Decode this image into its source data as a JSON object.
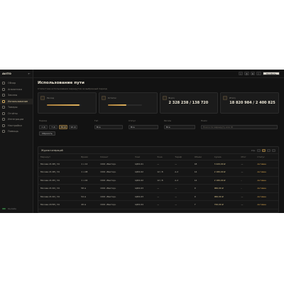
{
  "app": {
    "brand": "AVITO"
  },
  "sidebar": {
    "items": [
      {
        "label": "Обзор",
        "icon": "home-icon"
      },
      {
        "label": "Аналитика",
        "icon": "chart-icon"
      },
      {
        "label": "Заказы",
        "icon": "cart-icon"
      },
      {
        "label": "Использование",
        "icon": "wallet-icon",
        "active": true
      },
      {
        "label": "Товары",
        "icon": "box-icon"
      },
      {
        "label": "Отчёты",
        "icon": "report-icon"
      },
      {
        "label": "Интеграции",
        "icon": "plug-icon"
      },
      {
        "label": "Настройки",
        "icon": "gear-icon"
      },
      {
        "label": "Помощь",
        "icon": "help-icon"
      }
    ],
    "footer": "Онлайн"
  },
  "topbar": {
    "user": "Профиль"
  },
  "page": {
    "title": "Использование пути",
    "subtitle": "Статистика использования маршрутов за выбранный период"
  },
  "cards": [
    {
      "label": "Расход",
      "value": "",
      "progress": 0.95
    },
    {
      "label": "Остаток",
      "value": "",
      "progress": 0.55
    },
    {
      "label": "Всего",
      "value": "2 328 238 / 138 720",
      "progress": null
    },
    {
      "label": "Итого",
      "value": "18 820 984 / 2 400 825",
      "progress": null
    }
  ],
  "filters": {
    "period_label": "Период",
    "period_options": [
      "1 Д",
      "7 Д",
      "30 Д",
      "90 Д"
    ],
    "period_selected": 2,
    "type_label": "Тип",
    "type_value": "Все",
    "status_label": "Статус",
    "status_value": "Все",
    "region_label": "Регион",
    "region_value": "Все",
    "search_label": "Поиск",
    "search_placeholder": "Поиск по маршруту или ID",
    "reset_label": "Сбросить"
  },
  "table": {
    "title": "Журнал операций",
    "pager_label": "Стр.",
    "columns": [
      "Маршрут",
      "Время",
      "Клиент",
      "Узел",
      "Зона",
      "Тариф",
      "Объём",
      "Сумма",
      "Итог",
      "Статус"
    ],
    "rows": [
      [
        "Москва 21:08 | 34",
        "1 ч 12",
        "ООО «Вектор»",
        "ЦФО-01",
        "—",
        "—",
        "18",
        "3 420,00 ₽",
        "—",
        "Активен"
      ],
      [
        "Москва 21:08 | 34",
        "1 ч 08",
        "ООО «Вектор»",
        "ЦФО-02",
        "12 / 8",
        "А-2",
        "14",
        "2 180,00 ₽",
        "—",
        "Активен"
      ],
      [
        "Москва 21:05 | 34",
        "1 ч 02",
        "ООО «Вектор»",
        "ЦФО-02",
        "12 / 8",
        "А-2",
        "14",
        "2 180,00 ₽",
        "-",
        "Активен"
      ],
      [
        "Москва 21:04 | 34",
        "58 м",
        "ООО «Вектор»",
        "ЦФО-03",
        "—",
        "—",
        "9",
        "960,00 ₽",
        "-",
        "Активен"
      ],
      [
        "Москва 21:02 | 34",
        "54 м",
        "ООО «Вектор»",
        "ЦФО-03",
        "—",
        "—",
        "9",
        "960,00 ₽",
        "—",
        "Активен"
      ],
      [
        "Москва 20:58 | 34",
        "49 м",
        "ООО «Вектор»",
        "ЦФО-04",
        "—",
        "—",
        "7",
        "720,00 ₽",
        "—",
        "Активен"
      ]
    ]
  }
}
